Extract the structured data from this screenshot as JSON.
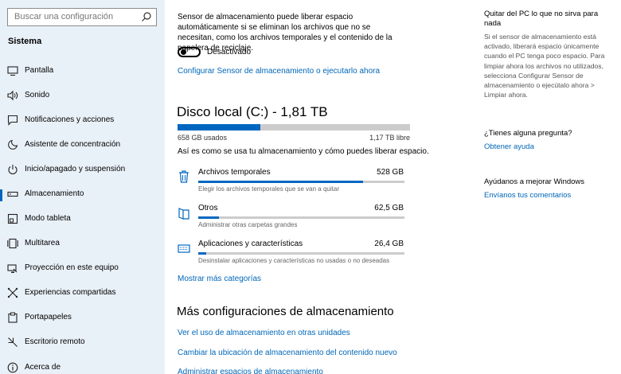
{
  "sidebar": {
    "search_placeholder": "Buscar una configuración",
    "section": "Sistema",
    "items": [
      {
        "label": "Pantalla",
        "icon": "monitor-icon"
      },
      {
        "label": "Sonido",
        "icon": "speaker-icon"
      },
      {
        "label": "Notificaciones y acciones",
        "icon": "notification-icon"
      },
      {
        "label": "Asistente de concentración",
        "icon": "moon-icon"
      },
      {
        "label": "Inicio/apagado y suspensión",
        "icon": "power-icon"
      },
      {
        "label": "Almacenamiento",
        "icon": "storage-icon",
        "active": true
      },
      {
        "label": "Modo tableta",
        "icon": "tablet-icon"
      },
      {
        "label": "Multitarea",
        "icon": "multitask-icon"
      },
      {
        "label": "Proyección en este equipo",
        "icon": "projection-icon"
      },
      {
        "label": "Experiencias compartidas",
        "icon": "shared-icon"
      },
      {
        "label": "Portapapeles",
        "icon": "clipboard-icon"
      },
      {
        "label": "Escritorio remoto",
        "icon": "remote-icon"
      },
      {
        "label": "Acerca de",
        "icon": "info-icon"
      }
    ]
  },
  "main": {
    "sensor_description": "Sensor de almacenamiento puede liberar espacio automáticamente si se eliminan los archivos que no se necesitan, como los archivos temporales y el contenido de la papelera de reciclaje.",
    "toggle_label": "Desactivado",
    "toggle_on": false,
    "configure_link": "Configurar Sensor de almacenamiento o ejecutarlo ahora",
    "disk": {
      "title": "Disco local (C:) - 1,81 TB",
      "used_label": "658 GB usados",
      "free_label": "1,17 TB libre",
      "used_fraction": 0.355
    },
    "disk_note": "Así es como se usa tu almacenamiento y cómo puedes liberar espacio.",
    "categories": [
      {
        "name": "Archivos temporales",
        "size": "528 GB",
        "desc": "Elegir los archivos temporales que se van a quitar",
        "fraction": 0.8,
        "icon": "trash-icon"
      },
      {
        "name": "Otros",
        "size": "62,5 GB",
        "desc": "Administrar otras carpetas grandes",
        "fraction": 0.1,
        "icon": "folder-icon"
      },
      {
        "name": "Aplicaciones y características",
        "size": "26,4 GB",
        "desc": "Desinstalar aplicaciones y características no usadas o no deseadas",
        "fraction": 0.04,
        "icon": "apps-icon"
      }
    ],
    "more_categories": "Mostrar más categorías",
    "more_settings_title": "Más configuraciones de almacenamiento",
    "more_links": [
      "Ver el uso de almacenamiento en otras unidades",
      "Cambiar la ubicación de almacenamiento del contenido nuevo",
      "Administrar espacios de almacenamiento"
    ]
  },
  "right": {
    "title": "Quitar del PC lo que no sirva para nada",
    "body": "Si el sensor de almacenamiento está activado, liberará espacio únicamente cuando el PC tenga poco espacio. Para limpiar ahora los archivos no utilizados, selecciona Configurar Sensor de almacenamiento o ejecútalo ahora > Limpiar ahora.",
    "question": "¿Tienes alguna pregunta?",
    "help_link": "Obtener ayuda",
    "improve": "Ayúdanos a mejorar Windows",
    "feedback_link": "Envíanos tus comentarios"
  },
  "colors": {
    "accent": "#0067c0",
    "sidebar_bg": "#e9f1f8",
    "link": "#0067b8"
  }
}
